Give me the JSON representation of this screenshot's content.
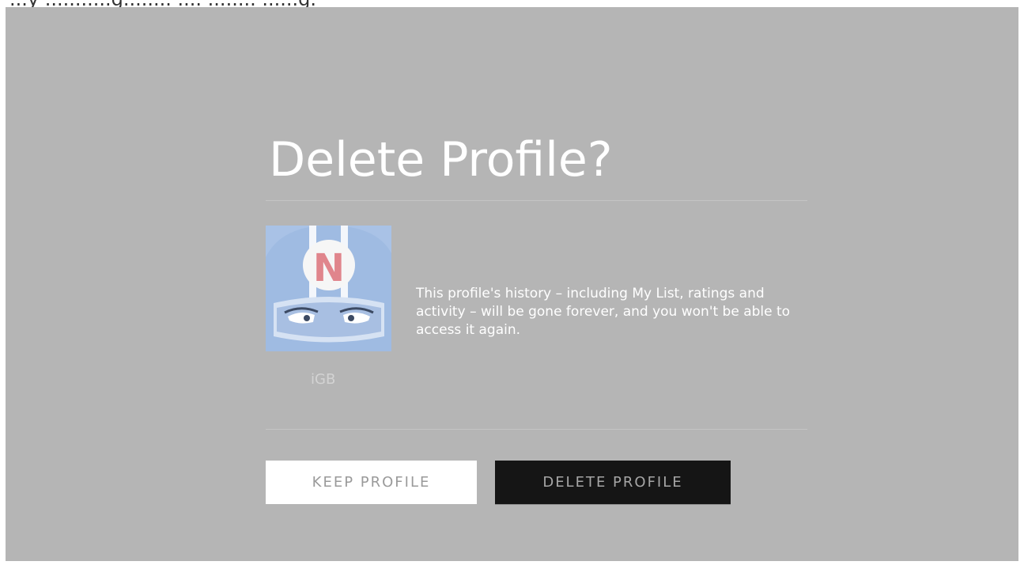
{
  "dialog": {
    "title": "Delete Profile?",
    "message": "This profile's history – including My List, ratings and activity – will be gone forever, and you won't be able to access it again.",
    "profile_name": "iGB",
    "avatar": {
      "icon": "netflix-kids-ninja-avatar",
      "letter": "N"
    }
  },
  "buttons": {
    "keep_label": "KEEP PROFILE",
    "delete_label": "DELETE PROFILE"
  },
  "colors": {
    "background": "#b5b5b5",
    "title_text": "#ffffff",
    "avatar_blue": "#a9c2e6",
    "netflix_red": "#e0858c",
    "delete_button_bg": "#151515",
    "keep_button_bg": "#ffffff"
  }
}
